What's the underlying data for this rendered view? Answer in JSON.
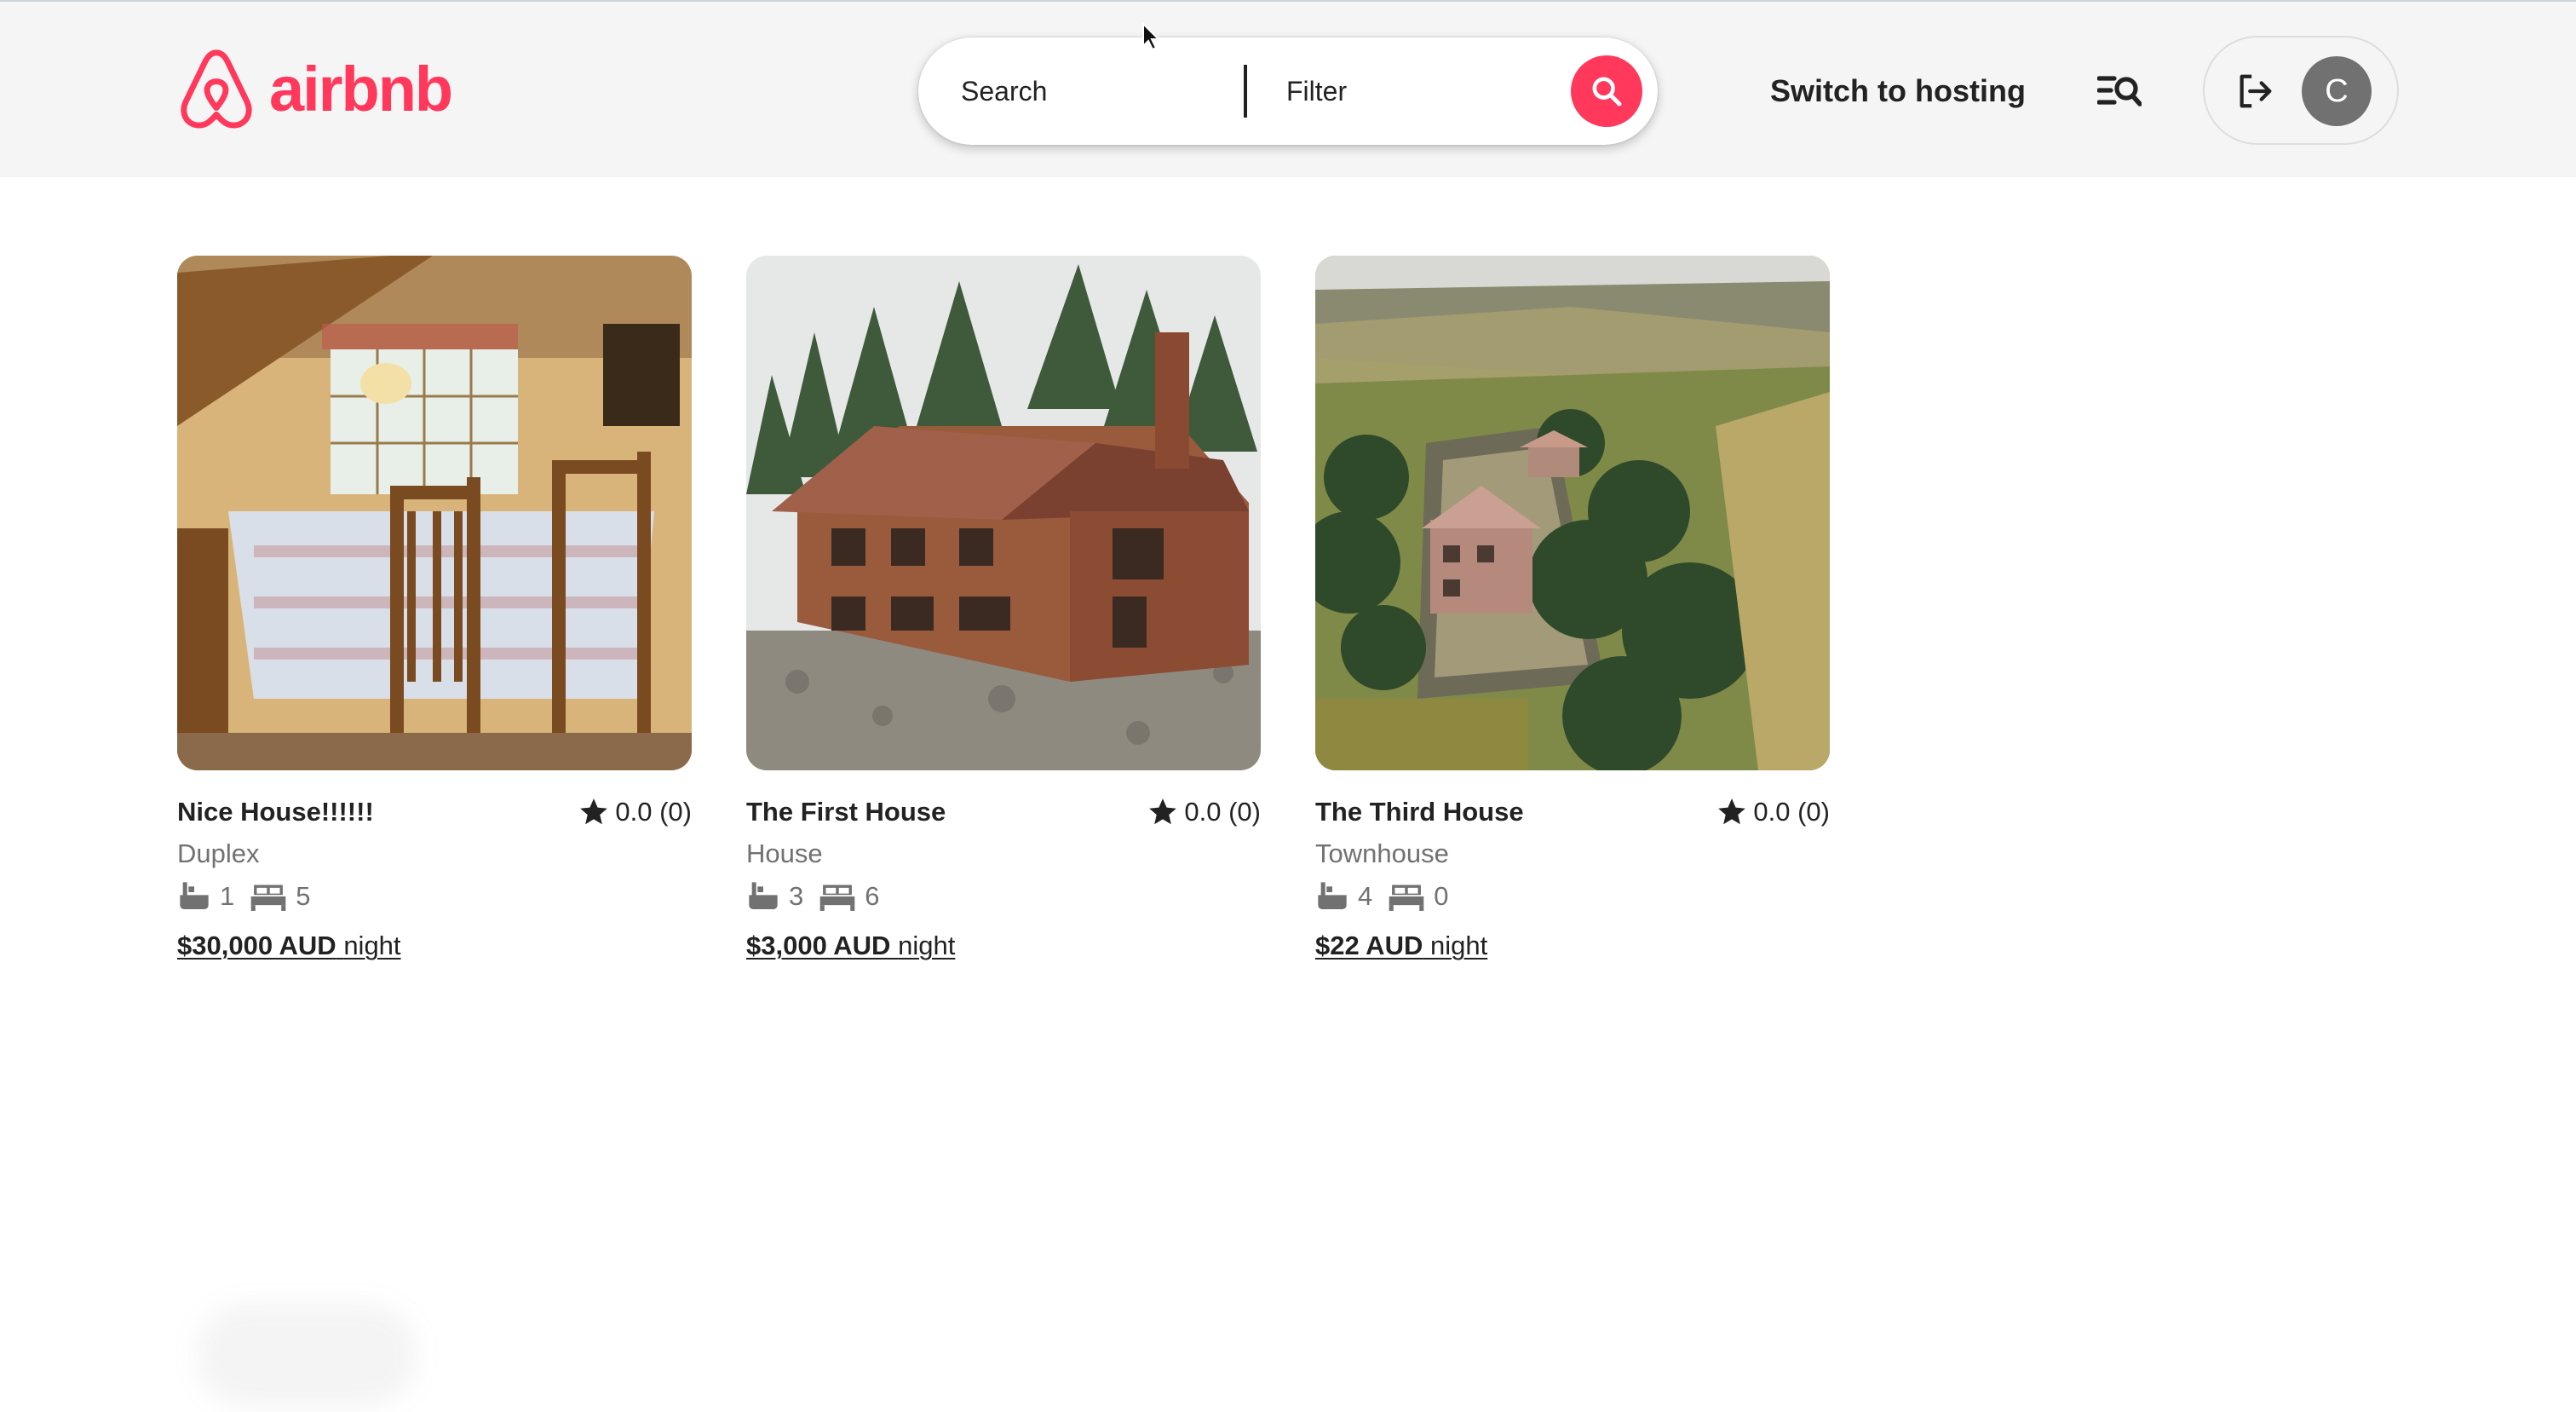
{
  "brand": {
    "name": "airbnb",
    "color": "#ff385c",
    "logo_icon": "airbnb-logo-icon"
  },
  "search": {
    "search_placeholder": "Search",
    "filter_placeholder": "Filter",
    "button_icon": "search-icon"
  },
  "nav": {
    "switch_to_hosting": "Switch to hosting",
    "list_search_icon": "list-search-icon",
    "logout_icon": "logout-icon",
    "avatar_initial": "C"
  },
  "listings": [
    {
      "title": "Nice House!!!!!!",
      "rating": "0.0 (0)",
      "type": "Duplex",
      "bathrooms": "1",
      "beds": "5",
      "price": "$30,000 AUD",
      "price_unit": "night",
      "image": "dining-room-photo"
    },
    {
      "title": "The First House",
      "rating": "0.0 (0)",
      "type": "House",
      "bathrooms": "3",
      "beds": "6",
      "price": "$3,000 AUD",
      "price_unit": "night",
      "image": "brick-house-photo"
    },
    {
      "title": "The Third House",
      "rating": "0.0 (0)",
      "type": "Townhouse",
      "bathrooms": "4",
      "beds": "0",
      "price": "$22 AUD",
      "price_unit": "night",
      "image": "hillside-aerial-photo"
    }
  ]
}
